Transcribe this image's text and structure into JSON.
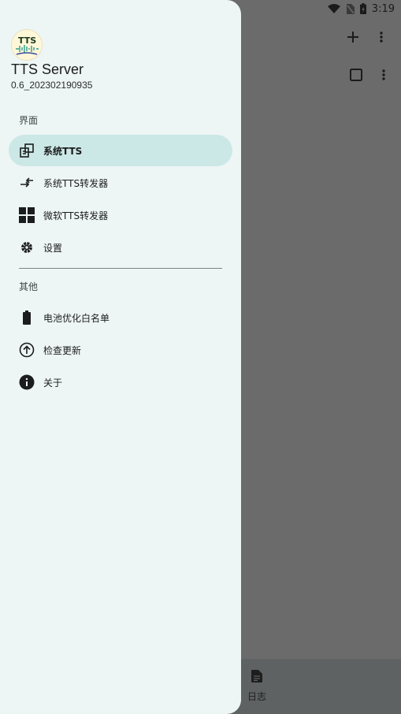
{
  "status_bar": {
    "time": "3:19"
  },
  "drawer": {
    "app_name": "TTS Server",
    "version": "0.6_202302190935",
    "section_interface": "界面",
    "section_other": "其他",
    "items": [
      {
        "label": "系统TTS",
        "icon": "system-tts-icon",
        "active": true
      },
      {
        "label": "系统TTS转发器",
        "icon": "swap-arrows-icon"
      },
      {
        "label": "微软TTS转发器",
        "icon": "windows-icon"
      },
      {
        "label": "设置",
        "icon": "gear-icon"
      }
    ],
    "other_items": [
      {
        "label": "电池优化白名单",
        "icon": "battery-icon"
      },
      {
        "label": "检查更新",
        "icon": "upload-circle-icon"
      },
      {
        "label": "关于",
        "icon": "info-icon"
      }
    ]
  },
  "background": {
    "bottom_tab_label": "日志"
  },
  "colors": {
    "drawer_bg": "#eef5f5",
    "active_item_bg": "#cce8e6",
    "scrim": "#6b6b6b"
  }
}
